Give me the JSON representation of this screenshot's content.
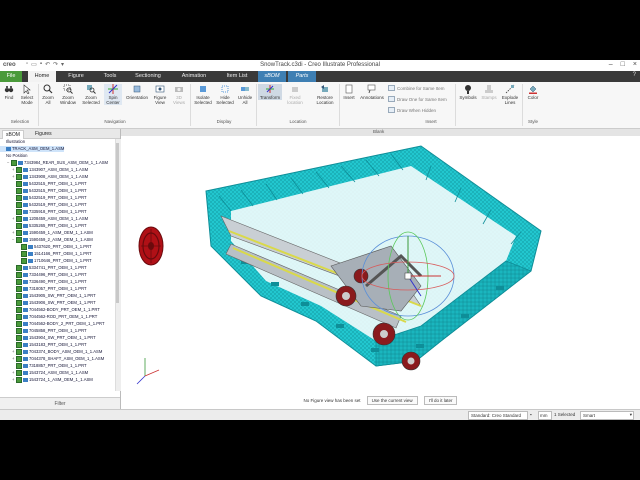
{
  "window": {
    "logo": "creo",
    "title": "SnowTrack.c3di - Creo Illustrate Professional"
  },
  "menu": {
    "tabs": [
      "File",
      "Home",
      "Figure",
      "Tools",
      "Sectioning",
      "Animation",
      "Item List",
      "sBOM",
      "Parts"
    ]
  },
  "ribbon": {
    "buttons": {
      "find": "Find",
      "select_mode": "Select Mode",
      "zoom_all": "Zoom All",
      "zoom_window": "Zoom Window",
      "zoom_selected": "Zoom Selected",
      "spin_center": "Spin Center",
      "orientation": "Orientation",
      "figure_view": "Figure View",
      "views_3d": "3D Views",
      "isolate_selected": "Isolate Selected",
      "hide_selected": "Hide Selected",
      "unhide_all": "Unhide All",
      "transform": "Transform",
      "fixed_location": "Fixed location",
      "restore_location": "Restore Location",
      "insert": "Insert",
      "annotations": "Annotations",
      "combine_same_item": "Combine for Same Item",
      "draw_one_same_item": "Draw One for Same Item",
      "draw_when_hidden": "Draw When Hidden",
      "symbols": "Symbols",
      "stamps": "Stamps",
      "explode_lines": "Explode Lines",
      "color": "Color"
    },
    "groups": {
      "selection": "Selection",
      "navigation": "Navigation",
      "display": "Display",
      "location": "Location",
      "insert": "Insert",
      "style": "Style"
    }
  },
  "section_label": "Blank",
  "left_panel": {
    "tabs": [
      "sBOM",
      "Figures"
    ],
    "filter_label": "Filter",
    "tree": [
      {
        "label": "Illustration",
        "level": 0,
        "toggle": "",
        "check": false,
        "icon": false
      },
      {
        "label": "TRACK_ASM_OEM_1.ASM",
        "level": 0,
        "toggle": "",
        "check": false,
        "icon": true,
        "selected": true
      },
      {
        "label": "No Position",
        "level": 0,
        "toggle": "",
        "check": false,
        "icon": false
      },
      {
        "label": "7343984_REAR_SUS_ASM_OEM_1_1.ASM",
        "level": 1,
        "toggle": "−",
        "check": true,
        "icon": true
      },
      {
        "label": "1343907_ASM_OEM_1_1.ASM",
        "level": 2,
        "toggle": "+",
        "check": true,
        "icon": true
      },
      {
        "label": "1343908_ASM_OEM_1_1.ASM",
        "level": 2,
        "toggle": "+",
        "check": true,
        "icon": true
      },
      {
        "label": "5432515_PRT_OEM_1_1.PRT",
        "level": 2,
        "toggle": "",
        "check": true,
        "icon": true
      },
      {
        "label": "5432515_PRT_OEM_1_1.PRT",
        "level": 2,
        "toggle": "",
        "check": true,
        "icon": true
      },
      {
        "label": "5432519_PRT_OEM_1_1.PRT",
        "level": 2,
        "toggle": "",
        "check": true,
        "icon": true
      },
      {
        "label": "5432519_PRT_OEM_1_1.PRT",
        "level": 2,
        "toggle": "",
        "check": true,
        "icon": true
      },
      {
        "label": "7335918_PRT_OEM_1_1.PRT",
        "level": 2,
        "toggle": "",
        "check": true,
        "icon": true
      },
      {
        "label": "1208459_ASM_OEM_1_1.ASM",
        "level": 2,
        "toggle": "+",
        "check": true,
        "icon": true
      },
      {
        "label": "5335265_PRT_OEM_1_1.PRT",
        "level": 2,
        "toggle": "",
        "check": true,
        "icon": true
      },
      {
        "label": "1590459_1_ASM_OEM_1_1.ASM",
        "level": 2,
        "toggle": "+",
        "check": true,
        "icon": true
      },
      {
        "label": "1590459_2_ASM_OEM_1_1.ASM",
        "level": 2,
        "toggle": "−",
        "check": true,
        "icon": true
      },
      {
        "label": "5437620_PRT_OEM_1_1.PRT",
        "level": 3,
        "toggle": "",
        "check": true,
        "icon": true
      },
      {
        "label": "1514166_PRT_OEM_1_1.PRT",
        "level": 3,
        "toggle": "",
        "check": true,
        "icon": true
      },
      {
        "label": "1710646_PRT_OEM_1_1.PRT",
        "level": 3,
        "toggle": "",
        "check": true,
        "icon": true
      },
      {
        "label": "5334741_PRT_OEM_1_1.PRT",
        "level": 2,
        "toggle": "",
        "check": true,
        "icon": true
      },
      {
        "label": "7334496_PRT_OEM_1_1.PRT",
        "level": 2,
        "toggle": "",
        "check": true,
        "icon": true
      },
      {
        "label": "7336490_PRT_OEM_1_1.PRT",
        "level": 2,
        "toggle": "",
        "check": true,
        "icon": true
      },
      {
        "label": "7318057_PRT_OEM_1_1.PRT",
        "level": 2,
        "toggle": "",
        "check": true,
        "icon": true
      },
      {
        "label": "1543905_SW_PRT_OEM_1_1.PRT",
        "level": 2,
        "toggle": "",
        "check": true,
        "icon": true
      },
      {
        "label": "1543906_SW_PRT_OEM_1_1.PRT",
        "level": 2,
        "toggle": "",
        "check": true,
        "icon": true
      },
      {
        "label": "7044562-BODY_PRT_OEM_1_1.PRT",
        "level": 2,
        "toggle": "",
        "check": true,
        "icon": true
      },
      {
        "label": "7044562-ROD_PRT_OEM_1_1.PRT",
        "level": 2,
        "toggle": "",
        "check": true,
        "icon": true
      },
      {
        "label": "7044562-BODY_2_PRT_OEM_1_1.PRT",
        "level": 2,
        "toggle": "",
        "check": true,
        "icon": true
      },
      {
        "label": "7045858_PRT_OEM_1_1.PRT",
        "level": 2,
        "toggle": "",
        "check": true,
        "icon": true
      },
      {
        "label": "1543904_SW_PRT_OEM_1_1.PRT",
        "level": 2,
        "toggle": "",
        "check": true,
        "icon": true
      },
      {
        "label": "1543183_PRT_OEM_1_1.PRT",
        "level": 2,
        "toggle": "",
        "check": true,
        "icon": true
      },
      {
        "label": "7043374_BODY_ASM_OEM_1_1.ASM",
        "level": 2,
        "toggle": "+",
        "check": true,
        "icon": true
      },
      {
        "label": "7044378_SHAFT_ASM_OEM_1_1.ASM",
        "level": 2,
        "toggle": "+",
        "check": true,
        "icon": true
      },
      {
        "label": "7318857_PRT_OEM_1_1.PRT",
        "level": 2,
        "toggle": "",
        "check": true,
        "icon": true
      },
      {
        "label": "1543724_ASM_OEM_1_1.ASM",
        "level": 2,
        "toggle": "+",
        "check": true,
        "icon": true
      },
      {
        "label": "1543724_1_ASM_OEM_1_1.ASM",
        "level": 2,
        "toggle": "+",
        "check": true,
        "icon": true
      }
    ]
  },
  "viewport": {
    "notice_text": "No Figure view has been set",
    "use_current_view": "Use the current view",
    "do_it_later": "I'll do it later",
    "colors": {
      "track": "#1ec8d0",
      "track_dark": "#0e8e98",
      "wheel": "#a80f12"
    }
  },
  "statusbar": {
    "standard": "Standard: Creo Standard",
    "units": "mm",
    "selected": "1 Selected",
    "filter": "Smart"
  }
}
